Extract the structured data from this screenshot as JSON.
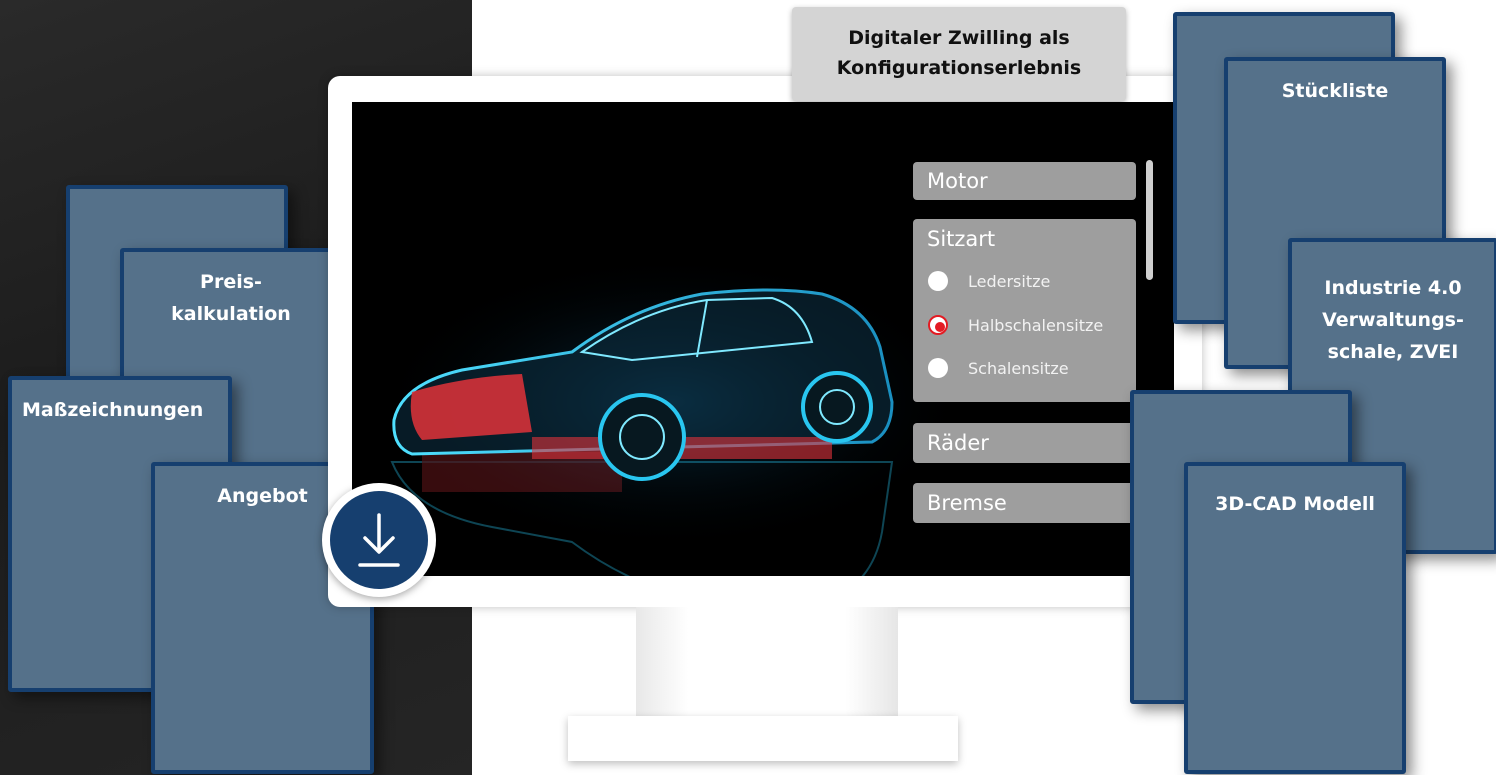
{
  "title": {
    "line1": "Digitaler Zwilling als",
    "line2": "Konfigurationserlebnis"
  },
  "left_cards": {
    "preis_line1": "Preis-",
    "preis_line2": "kalkulation",
    "masszeichnungen": "Maßzeichnungen",
    "angebot": "Angebot"
  },
  "right_cards": {
    "stueckliste": "Stückliste",
    "industrie_line1": "Industrie 4.0",
    "industrie_line2": "Verwaltungs-",
    "industrie_line3": "schale, ZVEI",
    "cad": "3D-CAD Modell"
  },
  "config": {
    "motor": "Motor",
    "sitzart": "Sitzart",
    "options": [
      {
        "label": "Ledersitze",
        "selected": false
      },
      {
        "label": "Halbschalensitze",
        "selected": true
      },
      {
        "label": "Schalensitze",
        "selected": false
      }
    ],
    "raeder": "Räder",
    "bremse": "Bremse"
  },
  "colors": {
    "card_fill": "#55718a",
    "card_border": "#163f6f",
    "accent_red": "#e31b23",
    "car_cyan": "#29c6f0"
  },
  "icons": {
    "download": "download-icon",
    "car": "car-xray-image"
  }
}
